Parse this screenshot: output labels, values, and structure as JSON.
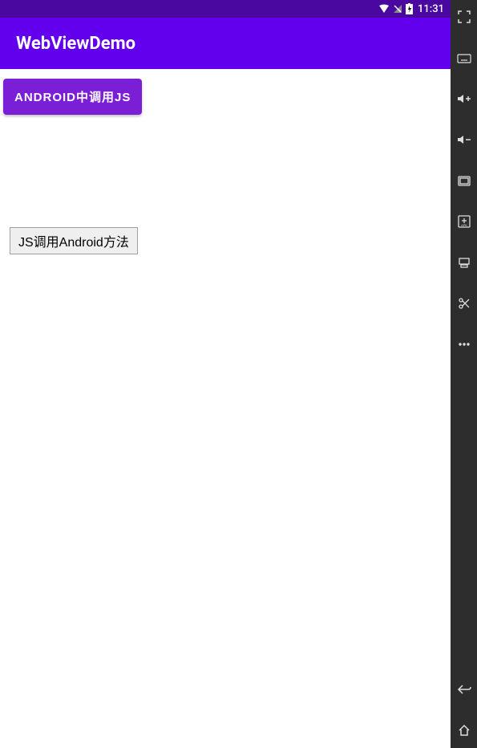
{
  "status_bar": {
    "time": "11:31"
  },
  "app_bar": {
    "title": "WebViewDemo"
  },
  "buttons": {
    "call_js": "ANDROID中调用JS",
    "call_android": "JS调用Android方法"
  }
}
